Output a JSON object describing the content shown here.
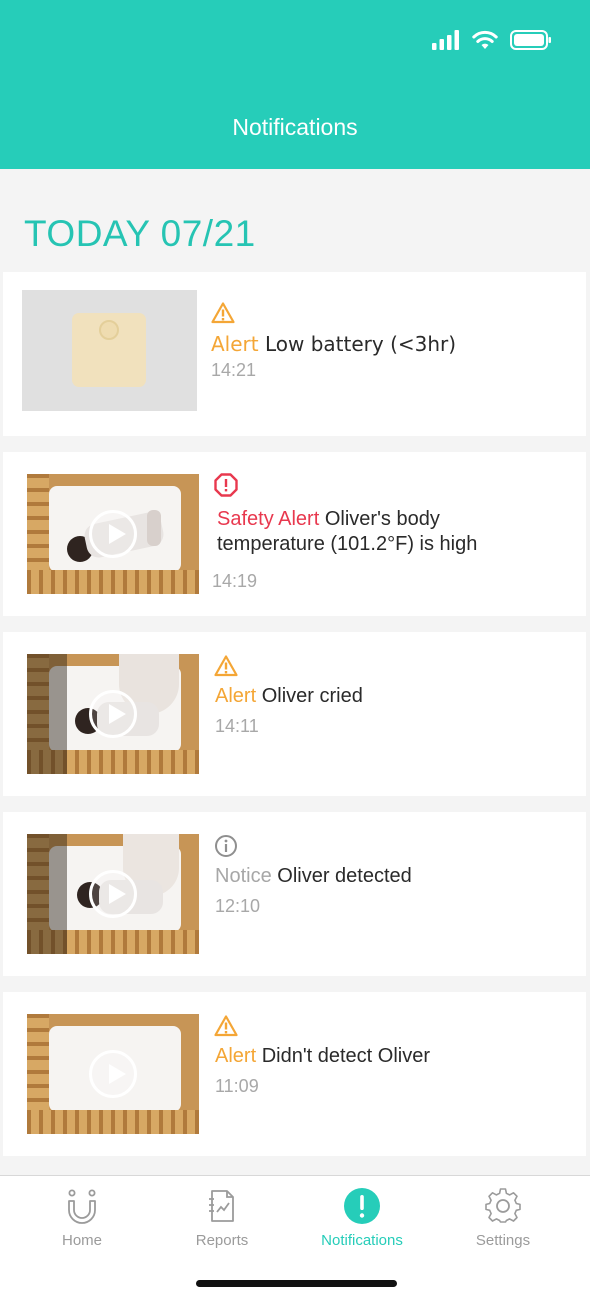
{
  "header": {
    "title": "Notifications"
  },
  "status_bar": {
    "icons": [
      "cellular-signal-icon",
      "wifi-icon",
      "battery-icon"
    ]
  },
  "section": {
    "title": "TODAY 07/21"
  },
  "notifications": [
    {
      "icon": "warning-icon",
      "tag": "Alert",
      "message": "Low battery (<3hr)",
      "time": "14:21",
      "thumb": "device-image"
    },
    {
      "icon": "safety-alert-icon",
      "tag": "Safety Alert",
      "message_line1": "Oliver's body",
      "message_line2": "temperature (101.2°F) is high",
      "time": "14:19",
      "thumb": "video"
    },
    {
      "icon": "warning-icon",
      "tag": "Alert",
      "message": "Oliver cried",
      "time": "14:11",
      "thumb": "video"
    },
    {
      "icon": "info-icon",
      "tag": "Notice",
      "message": "Oliver detected",
      "time": "12:10",
      "thumb": "video"
    },
    {
      "icon": "warning-icon",
      "tag": "Alert",
      "message": "Didn't detect Oliver",
      "time": "11:09",
      "thumb": "video"
    }
  ],
  "tabs": [
    {
      "label": "Home",
      "icon": "home-icon"
    },
    {
      "label": "Reports",
      "icon": "reports-icon"
    },
    {
      "label": "Notifications",
      "icon": "notifications-icon",
      "active": true
    },
    {
      "label": "Settings",
      "icon": "gear-icon"
    }
  ],
  "colors": {
    "brand": "#26cdb9",
    "alert": "#f4a636",
    "safety_alert": "#e8384e",
    "notice": "#a7a7a7"
  }
}
